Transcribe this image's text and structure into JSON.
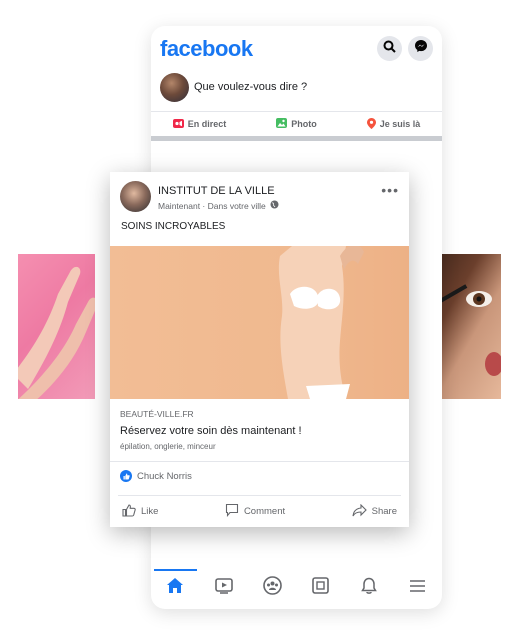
{
  "app": {
    "logo": "facebook",
    "accent_color": "#1877f2",
    "icons": {
      "search": "search-icon",
      "messenger": "messenger-icon"
    }
  },
  "composer": {
    "prompt": "Que voulez-vous dire ?",
    "actions": [
      {
        "label": "En direct",
        "icon": "live-video-icon",
        "color": "#f02849"
      },
      {
        "label": "Photo",
        "icon": "photo-icon",
        "color": "#45bd62"
      },
      {
        "label": "Je suis là",
        "icon": "location-pin-icon",
        "color": "#f5533d"
      }
    ]
  },
  "post": {
    "page_name": "INSTITUT DE LA VILLE",
    "meta": "Maintenant · Dans votre ville",
    "privacy_icon": "globe-icon",
    "text": "SOINS INCROYABLES",
    "link": {
      "domain": "BEAUTÉ-VILLE.FR",
      "title": "Réservez votre soin dès maintenant !",
      "description": "épilation, onglerie, minceur"
    },
    "reaction_by": "Chuck Norris",
    "actions": {
      "like": "Like",
      "comment": "Comment",
      "share": "Share"
    }
  },
  "bottom_nav": [
    "home-icon",
    "video-icon",
    "groups-icon",
    "pages-icon",
    "notifications-icon",
    "menu-icon"
  ]
}
